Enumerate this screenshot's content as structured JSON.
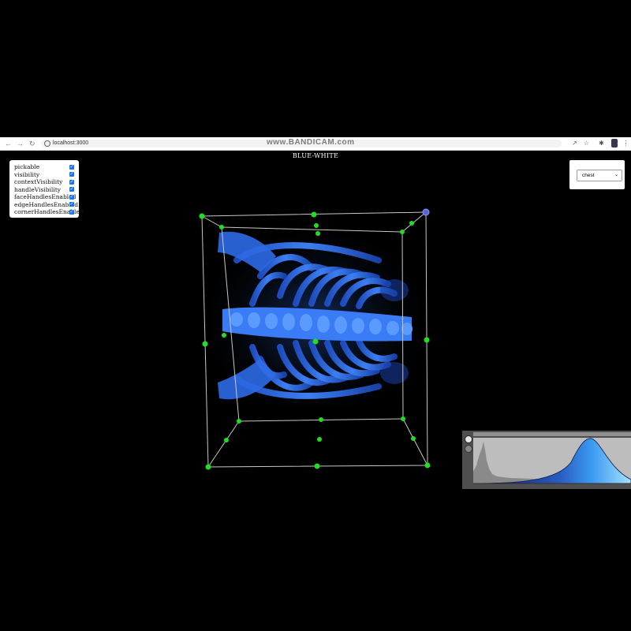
{
  "browser": {
    "back_icon": "arrow-left-icon",
    "forward_icon": "arrow-right-icon",
    "reload_icon": "reload-icon",
    "url": "localhost:3000",
    "watermark": "www.BANDICAM.com",
    "toolbar_icons": [
      "share-icon",
      "star-icon",
      "extensions-icon",
      "profile-icon",
      "menu-icon"
    ]
  },
  "colormap": {
    "name": "BLUE-WHITE"
  },
  "widget_options": [
    {
      "label": "pickable",
      "checked": true
    },
    {
      "label": "visibility",
      "checked": true
    },
    {
      "label": "contextVisibility",
      "checked": true
    },
    {
      "label": "handleVisibility",
      "checked": true
    },
    {
      "label": "faceHandlesEnabled",
      "checked": true
    },
    {
      "label": "edgeHandlesEnabled",
      "checked": true
    },
    {
      "label": "cornerHandlesEnabled",
      "checked": true
    }
  ],
  "dataset": {
    "selected": "chest"
  },
  "colors": {
    "background": "#000000",
    "handle": "#22dd22",
    "box_outline": "#c8c8c8",
    "volume_blue": "#2a68e0",
    "tf_gradient_start": "#0a1460",
    "tf_gradient_end": "#a8e0ff"
  },
  "transfer_function": {
    "add_icon": "add-point-icon",
    "remove_icon": "remove-point-icon"
  }
}
